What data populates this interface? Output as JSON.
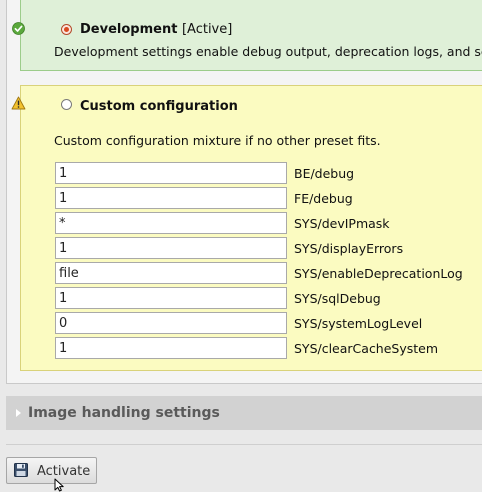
{
  "presets": {
    "development": {
      "name": "Development",
      "state": "[Active]",
      "description": "Development settings enable debug output, deprecation logs, and set lo",
      "selected": true
    },
    "custom": {
      "name": "Custom configuration",
      "description": "Custom configuration mixture if no other preset fits.",
      "selected": false,
      "fields": [
        {
          "value": "1",
          "label": "BE/debug"
        },
        {
          "value": "1",
          "label": "FE/debug"
        },
        {
          "value": "*",
          "label": "SYS/devIPmask"
        },
        {
          "value": "1",
          "label": "SYS/displayErrors"
        },
        {
          "value": "file",
          "label": "SYS/enableDeprecationLog"
        },
        {
          "value": "1",
          "label": "SYS/sqlDebug"
        },
        {
          "value": "0",
          "label": "SYS/systemLogLevel"
        },
        {
          "value": "1",
          "label": "SYS/clearCacheSystem"
        }
      ]
    }
  },
  "sections": {
    "image_handling": "Image handling settings"
  },
  "actions": {
    "activate_label": "Activate"
  },
  "icons": {
    "success": "check-circle-icon",
    "warning": "warning-triangle-icon",
    "save": "floppy-disk-icon",
    "cursor": "mouse-pointer-icon",
    "expand": "chevron-right-icon"
  },
  "colors": {
    "success_bg": "#dff0d8",
    "warning_bg": "#fbfbc1",
    "section_bg": "#d2d2d2",
    "radio_selected": "#d9491f"
  }
}
